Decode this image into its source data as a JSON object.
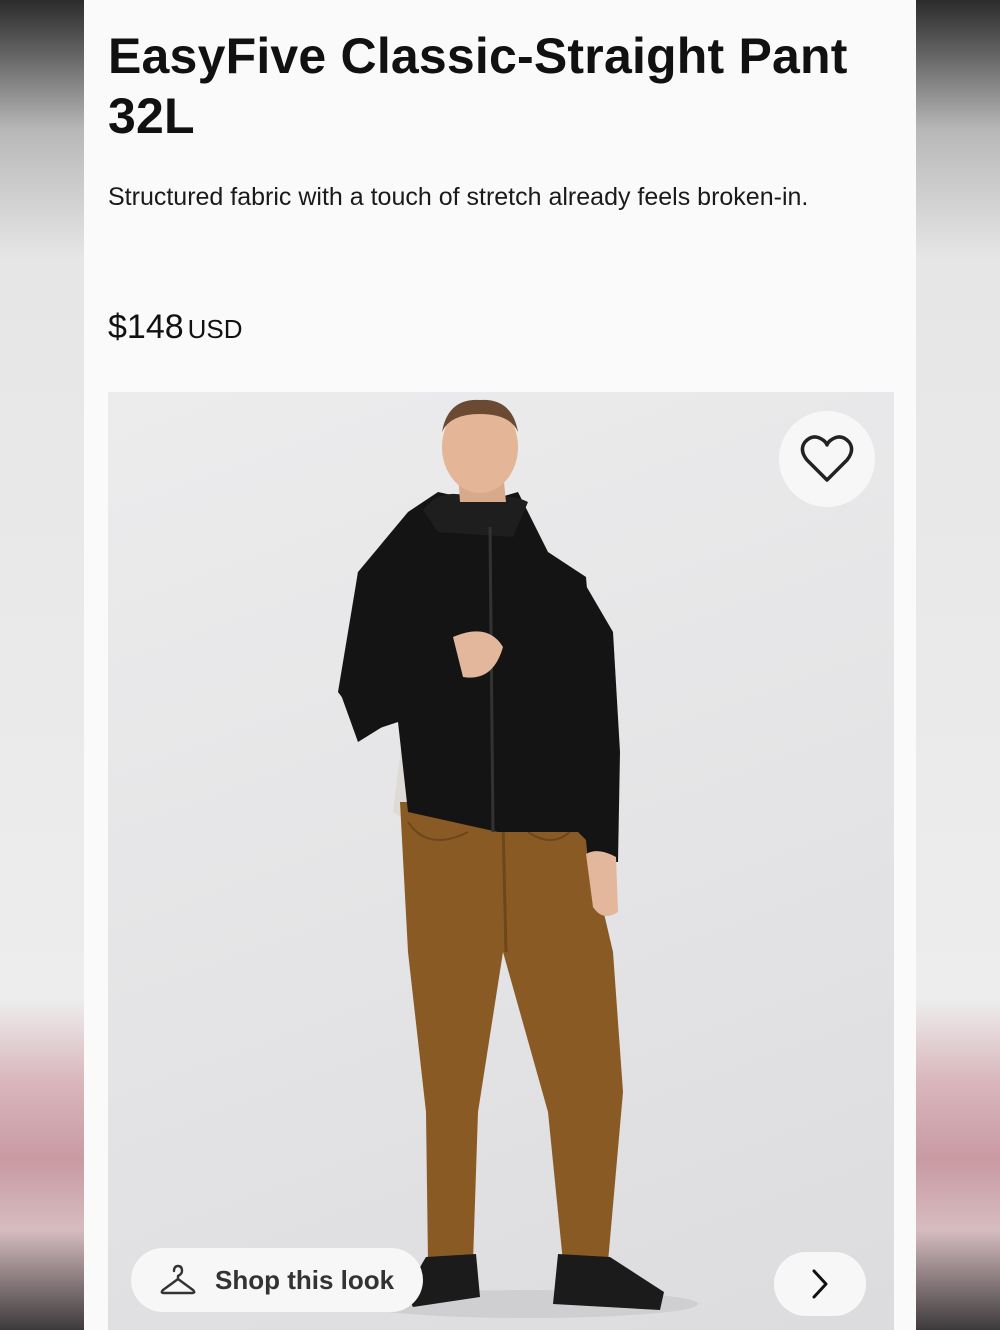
{
  "product": {
    "title": "EasyFive Classic-Straight Pant 32L",
    "description": "Structured fabric with a touch of stretch already feels broken-in.",
    "price": "$148",
    "currency": "USD"
  },
  "gallery": {
    "favorite_icon": "heart-outline-icon",
    "shop_the_look": {
      "label": "Shop this look",
      "icon": "hanger-icon"
    },
    "next_icon": "chevron-right-icon"
  },
  "colors": {
    "page_bg": "#fafafa",
    "text": "#111111",
    "image_bg": "#e6e6e8",
    "jacket": "#141414",
    "pants": "#8a5a24"
  }
}
